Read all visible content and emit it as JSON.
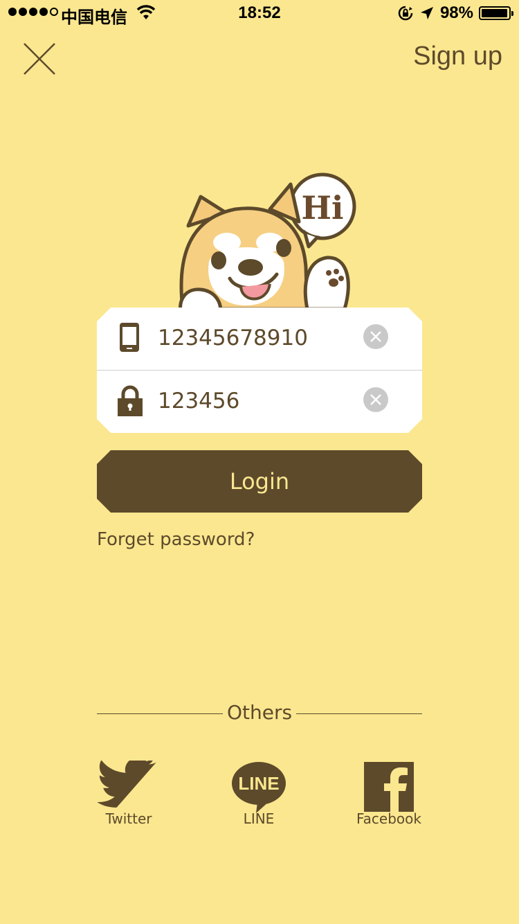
{
  "status_bar": {
    "carrier": "中国电信",
    "time": "18:52",
    "battery_percent_label": "98%",
    "battery_level": 0.98,
    "signal_bars_filled": 4,
    "signal_bars_total": 5
  },
  "header": {
    "close_icon": "close-icon",
    "signup_label": "Sign up"
  },
  "mascot": {
    "speech_text": "Hi"
  },
  "form": {
    "phone_value": "12345678910",
    "password_value": "123456",
    "phone_icon": "phone-icon",
    "lock_icon": "lock-icon",
    "clear_icon": "clear-icon"
  },
  "login_label": "Login",
  "forget_label": "Forget password?",
  "others": {
    "label": "Others",
    "items": [
      {
        "label": "Twitter",
        "icon": "twitter-icon"
      },
      {
        "label": "LINE",
        "icon": "line-icon"
      },
      {
        "label": "Facebook",
        "icon": "facebook-icon"
      }
    ]
  },
  "colors": {
    "background": "#fbe78f",
    "brown": "#5d4a2b",
    "card": "#ffffff",
    "clear_button": "#c9c9c9"
  }
}
